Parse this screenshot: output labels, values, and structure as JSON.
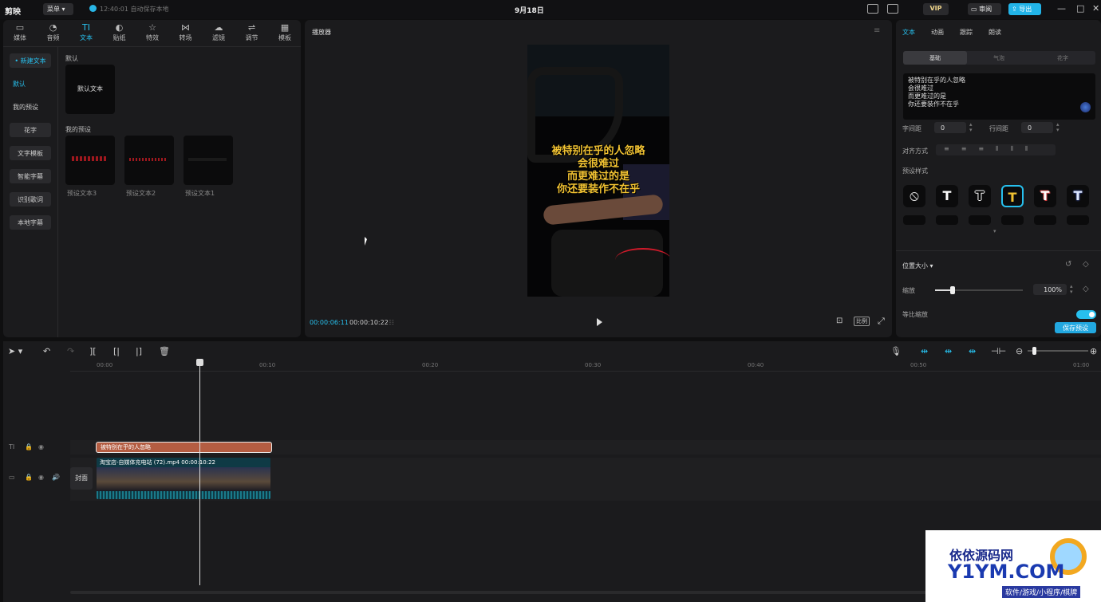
{
  "topbar": {
    "logo": "剪映",
    "menu": "菜单",
    "save_status": "12:40:01 自动保存本地",
    "project_title": "9月18日",
    "vip": "VIP",
    "review": "审阅",
    "export": "导出"
  },
  "left": {
    "tabs": [
      {
        "icon": "▭",
        "label": "媒体"
      },
      {
        "icon": "◔",
        "label": "音频"
      },
      {
        "icon": "TI",
        "label": "文本"
      },
      {
        "icon": "◐",
        "label": "贴纸"
      },
      {
        "icon": "☆",
        "label": "特效"
      },
      {
        "icon": "⋈",
        "label": "转场"
      },
      {
        "icon": "☁",
        "label": "滤镜"
      },
      {
        "icon": "⇌",
        "label": "调节"
      },
      {
        "icon": "▦",
        "label": "模板"
      }
    ],
    "sidebar": [
      "新建文本",
      "默认",
      "我的预设",
      "花字",
      "文字模板",
      "智能字幕",
      "识别歌词",
      "本地字幕"
    ],
    "section_default": "默认",
    "default_card": "默认文本",
    "section_presets": "我的预设",
    "presets": [
      "预设文本3",
      "预设文本2",
      "预设文本1"
    ]
  },
  "player": {
    "title": "播放器",
    "subtitle_lines": [
      "被特别在乎的人忽略",
      "会很难过",
      "而更难过的是",
      "你还要装作不在乎"
    ],
    "current_time": "00:00:06:11",
    "total_time": "00:00:10:22",
    "ratio": "比例"
  },
  "right": {
    "tabs": [
      "文本",
      "动画",
      "跟踪",
      "朗读"
    ],
    "subtabs": [
      "基础",
      "气泡",
      "花字"
    ],
    "text_lines": [
      "被特别在乎的人忽略",
      "会很难过",
      "而更难过的是",
      "你还要装作不在乎"
    ],
    "char_spacing_label": "字间距",
    "char_spacing": "0",
    "line_spacing_label": "行间距",
    "line_spacing": "0",
    "align_label": "对齐方式",
    "preset_style_label": "预设样式",
    "position_size": "位置大小",
    "scale_label": "缩放",
    "scale": 0.2,
    "scale_value": "100%",
    "uniform_scale": "等比缩放",
    "save_preset": "保存预设"
  },
  "timeline": {
    "ticks": [
      "00:00",
      "00:10",
      "00:20",
      "00:30",
      "00:40",
      "00:50",
      "01:00"
    ],
    "text_clip": "被特别在乎的人忽略",
    "video_clip": "淘宝店-自媒体充电站 (72).mp4   00:00:10:22",
    "cover": "封面"
  },
  "watermark": {
    "line1": "依依源码网",
    "line2": "Y1YM.COM",
    "line3": "软件/游戏/小程序/棋牌"
  },
  "colors": {
    "accent": "#27c0ee",
    "subtitle": "#f1c232",
    "text_clip": "#b45d42",
    "video_clip": "#0f3a45"
  }
}
